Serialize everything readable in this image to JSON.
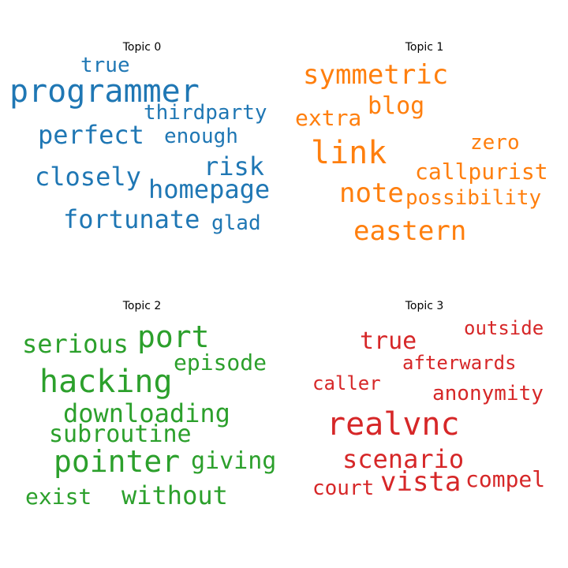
{
  "chart_data": {
    "type": "wordcloud",
    "topics": [
      {
        "title": "Topic 0",
        "color": "#1f77b4",
        "words": [
          "programmer",
          "true",
          "thirdparty",
          "perfect",
          "enough",
          "risk",
          "closely",
          "homepage",
          "fortunate",
          "glad"
        ]
      },
      {
        "title": "Topic 1",
        "color": "#ff7f0e",
        "words": [
          "symmetric",
          "blog",
          "extra",
          "link",
          "zero",
          "callpurist",
          "note",
          "possibility",
          "eastern"
        ]
      },
      {
        "title": "Topic 2",
        "color": "#2ca02c",
        "words": [
          "serious",
          "port",
          "episode",
          "hacking",
          "downloading",
          "subroutine",
          "pointer",
          "giving",
          "exist",
          "without"
        ]
      },
      {
        "title": "Topic 3",
        "color": "#d62728",
        "words": [
          "outside",
          "true",
          "afterwards",
          "caller",
          "anonymity",
          "realvnc",
          "scenario",
          "court",
          "vista",
          "compel"
        ]
      }
    ]
  }
}
